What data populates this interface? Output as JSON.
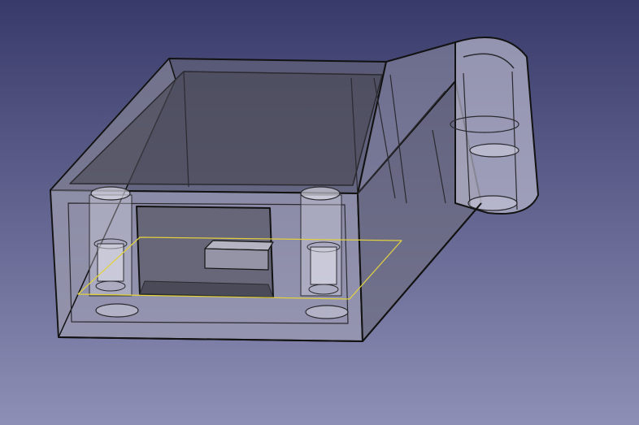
{
  "viewport": {
    "background_top": "#383a6a",
    "background_bottom": "#8e8fb6",
    "model_fill": "#b4b4c8",
    "model_edge": "#111111",
    "plane_outline": "#e0d040"
  },
  "icons": {
    "model": "3d-part-icon",
    "section_plane": "sketch-plane-icon"
  }
}
